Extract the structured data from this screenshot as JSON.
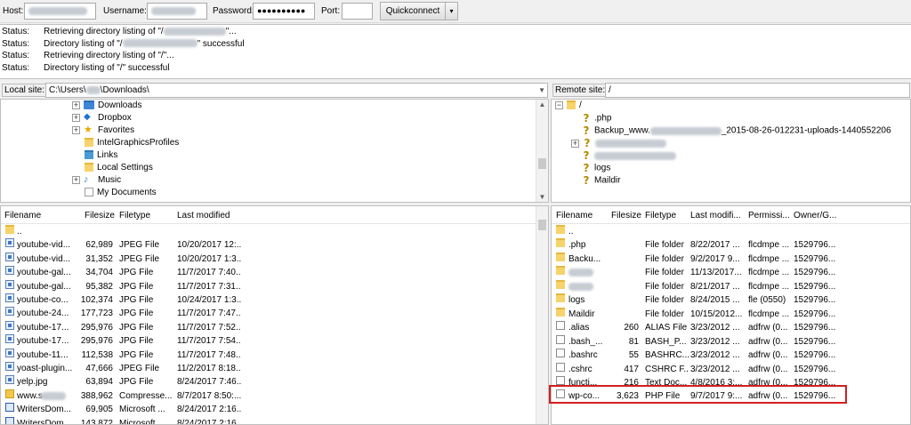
{
  "quickconnect": {
    "host_label": "Host:",
    "username_label": "Username:",
    "password_label": "Password:",
    "password_value": "●●●●●●●●●●",
    "port_label": "Port:",
    "port_value": "",
    "button": "Quickconnect",
    "dropdown": "▾"
  },
  "log": [
    {
      "key": "Status:",
      "pre": "Retrieving directory listing of \"/",
      "post": "\"..."
    },
    {
      "key": "Status:",
      "pre": "Directory listing of \"/",
      "post": "\" successful"
    },
    {
      "key": "Status:",
      "pre": "Retrieving directory listing of \"/\"...",
      "post": ""
    },
    {
      "key": "Status:",
      "pre": "Directory listing of \"/\" successful",
      "post": ""
    }
  ],
  "local_site": {
    "label": "Local site:",
    "path_prefix": "C:\\Users\\",
    "path_suffix": "\\Downloads\\",
    "tree": [
      "Downloads",
      "Dropbox",
      "Favorites",
      "IntelGraphicsProfiles",
      "Links",
      "Local Settings",
      "Music",
      "My Documents"
    ],
    "columns": [
      "Filename",
      "Filesize",
      "Filetype",
      "Last modified"
    ],
    "files": [
      {
        "name": "..",
        "size": "",
        "type": "",
        "modified": "",
        "icon": "folder"
      },
      {
        "name": "youtube-vid...",
        "size": "62,989",
        "type": "JPEG File",
        "modified": "10/20/2017 12:...",
        "icon": "jpg"
      },
      {
        "name": "youtube-vid...",
        "size": "31,352",
        "type": "JPEG File",
        "modified": "10/20/2017 1:3...",
        "icon": "jpg"
      },
      {
        "name": "youtube-gal...",
        "size": "34,704",
        "type": "JPG File",
        "modified": "11/7/2017 7:40...",
        "icon": "jpg"
      },
      {
        "name": "youtube-gal...",
        "size": "95,382",
        "type": "JPG File",
        "modified": "11/7/2017 7:31...",
        "icon": "jpg"
      },
      {
        "name": "youtube-co...",
        "size": "102,374",
        "type": "JPG File",
        "modified": "10/24/2017 1:3...",
        "icon": "jpg"
      },
      {
        "name": "youtube-24...",
        "size": "177,723",
        "type": "JPG File",
        "modified": "11/7/2017 7:47...",
        "icon": "jpg"
      },
      {
        "name": "youtube-17...",
        "size": "295,976",
        "type": "JPG File",
        "modified": "11/7/2017 7:52...",
        "icon": "jpg"
      },
      {
        "name": "youtube-17...",
        "size": "295,976",
        "type": "JPG File",
        "modified": "11/7/2017 7:54...",
        "icon": "jpg"
      },
      {
        "name": "youtube-11...",
        "size": "112,538",
        "type": "JPG File",
        "modified": "11/7/2017 7:48...",
        "icon": "jpg"
      },
      {
        "name": "yoast-plugin...",
        "size": "47,666",
        "type": "JPEG File",
        "modified": "11/2/2017 8:18...",
        "icon": "jpg"
      },
      {
        "name": "yelp.jpg",
        "size": "63,894",
        "type": "JPG File",
        "modified": "8/24/2017 7:46...",
        "icon": "jpg"
      },
      {
        "name": "www.s",
        "size": "388,962",
        "type": "Compresse...",
        "modified": "8/7/2017 8:50:...",
        "icon": "zip"
      },
      {
        "name": "WritersDom...",
        "size": "69,905",
        "type": "Microsoft ...",
        "modified": "8/24/2017 2:16...",
        "icon": "doc"
      },
      {
        "name": "WritersDom...",
        "size": "143,872",
        "type": "Microsoft ...",
        "modified": "8/24/2017 2:16...",
        "icon": "doc"
      }
    ]
  },
  "remote_site": {
    "label": "Remote site:",
    "path": "/",
    "tree": {
      "root": "/",
      "items": [
        ".php",
        "Backup_www.",
        "_2015-08-26-012231-uploads-1440552206",
        "logs",
        "Maildir"
      ]
    },
    "columns": [
      "Filename",
      "Filesize",
      "Filetype",
      "Last modifi...",
      "Permissi...",
      "Owner/G..."
    ],
    "files": [
      {
        "name": "..",
        "size": "",
        "type": "",
        "modified": "",
        "perm": "",
        "owner": "",
        "icon": "folder"
      },
      {
        "name": ".php",
        "size": "",
        "type": "File folder",
        "modified": "8/22/2017 ...",
        "perm": "flcdmpe ...",
        "owner": "1529796...",
        "icon": "folder"
      },
      {
        "name": "Backu...",
        "size": "",
        "type": "File folder",
        "modified": "9/2/2017 9...",
        "perm": "flcdmpe ...",
        "owner": "1529796...",
        "icon": "folder"
      },
      {
        "name": "",
        "size": "",
        "type": "File folder",
        "modified": "11/13/2017...",
        "perm": "flcdmpe ...",
        "owner": "1529796...",
        "icon": "folder"
      },
      {
        "name": "",
        "size": "",
        "type": "File folder",
        "modified": "8/21/2017 ...",
        "perm": "flcdmpe ...",
        "owner": "1529796...",
        "icon": "folder"
      },
      {
        "name": "logs",
        "size": "",
        "type": "File folder",
        "modified": "8/24/2015 ...",
        "perm": "fle (0550)",
        "owner": "1529796...",
        "icon": "folder"
      },
      {
        "name": "Maildir",
        "size": "",
        "type": "File folder",
        "modified": "10/15/2012...",
        "perm": "flcdmpe ...",
        "owner": "1529796...",
        "icon": "folder"
      },
      {
        "name": ".alias",
        "size": "260",
        "type": "ALIAS File",
        "modified": "3/23/2012 ...",
        "perm": "adfrw (0...",
        "owner": "1529796...",
        "icon": "file"
      },
      {
        "name": ".bash_...",
        "size": "81",
        "type": "BASH_P...",
        "modified": "3/23/2012 ...",
        "perm": "adfrw (0...",
        "owner": "1529796...",
        "icon": "file"
      },
      {
        "name": ".bashrc",
        "size": "55",
        "type": "BASHRC...",
        "modified": "3/23/2012 ...",
        "perm": "adfrw (0...",
        "owner": "1529796...",
        "icon": "file"
      },
      {
        "name": ".cshrc",
        "size": "417",
        "type": "CSHRC F...",
        "modified": "3/23/2012 ...",
        "perm": "adfrw (0...",
        "owner": "1529796...",
        "icon": "file"
      },
      {
        "name": "functi...",
        "size": "216",
        "type": "Text Doc...",
        "modified": "4/8/2016 3:...",
        "perm": "adfrw (0...",
        "owner": "1529796...",
        "icon": "file"
      },
      {
        "name": "wp-co...",
        "size": "3,623",
        "type": "PHP File",
        "modified": "9/7/2017 9:...",
        "perm": "adfrw (0...",
        "owner": "1529796...",
        "icon": "file"
      }
    ]
  },
  "colors": {
    "highlight": "#d21f1f",
    "folder": "#f6d36b"
  }
}
